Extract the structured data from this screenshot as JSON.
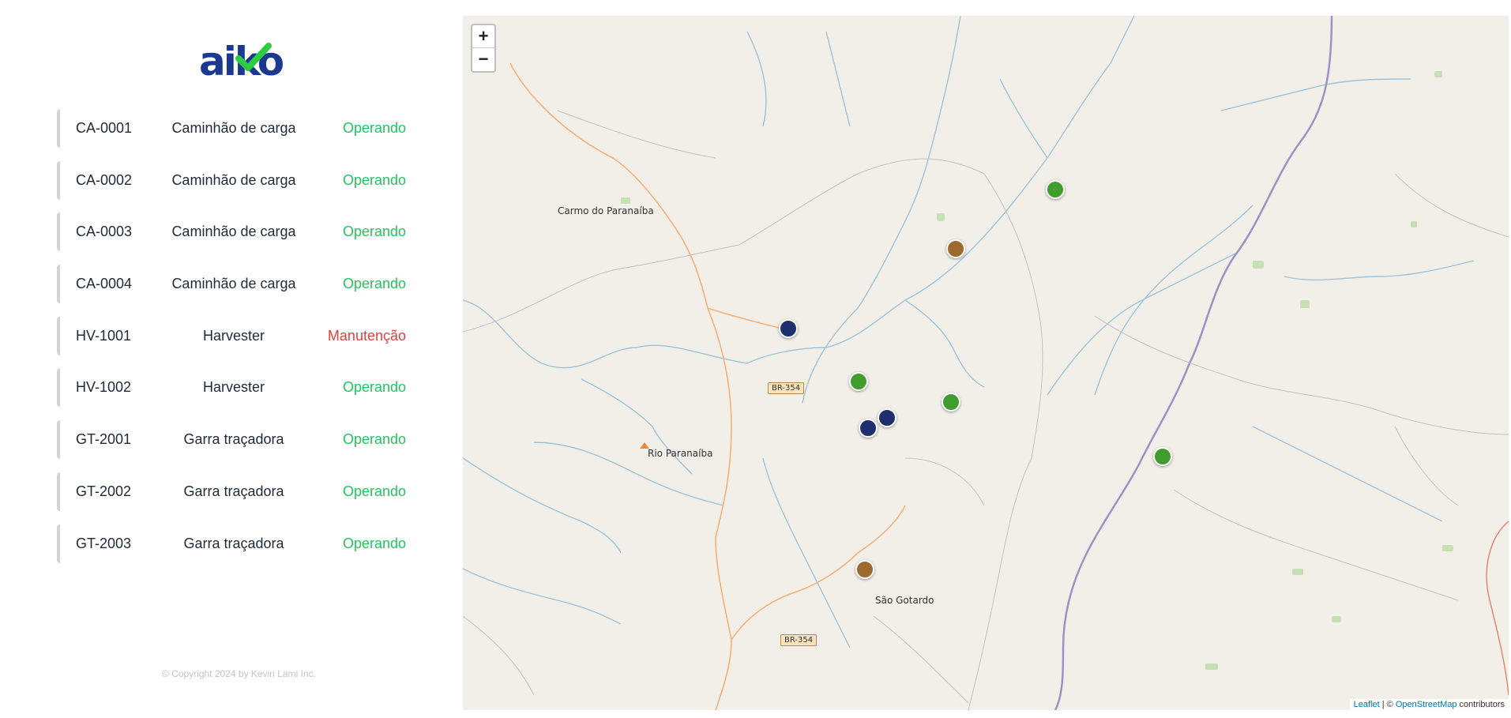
{
  "brand": {
    "logo_text": "aiko",
    "check_color": "#2ecc40",
    "logo_color": "#1b3a8f"
  },
  "equipment": [
    {
      "code": "CA-0001",
      "model": "Caminhão de carga",
      "state": "Operando",
      "state_color": "#22c55e"
    },
    {
      "code": "CA-0002",
      "model": "Caminhão de carga",
      "state": "Operando",
      "state_color": "#22c55e"
    },
    {
      "code": "CA-0003",
      "model": "Caminhão de carga",
      "state": "Operando",
      "state_color": "#22c55e"
    },
    {
      "code": "CA-0004",
      "model": "Caminhão de carga",
      "state": "Operando",
      "state_color": "#22c55e"
    },
    {
      "code": "HV-1001",
      "model": "Harvester",
      "state": "Manutenção",
      "state_color": "#e53e3e"
    },
    {
      "code": "HV-1002",
      "model": "Harvester",
      "state": "Operando",
      "state_color": "#22c55e"
    },
    {
      "code": "GT-2001",
      "model": "Garra traçadora",
      "state": "Operando",
      "state_color": "#22c55e"
    },
    {
      "code": "GT-2002",
      "model": "Garra traçadora",
      "state": "Operando",
      "state_color": "#22c55e"
    },
    {
      "code": "GT-2003",
      "model": "Garra traçadora",
      "state": "Operando",
      "state_color": "#22c55e"
    }
  ],
  "footer": {
    "copyright": "© Copyright 2024 by Kevin Lami Inc."
  },
  "map": {
    "zoom_in": "+",
    "zoom_out": "−",
    "places": [
      "Carmo do Paranaíba",
      "Rio Paranaíba",
      "São Gotardo"
    ],
    "road_label": "BR-354",
    "attribution": {
      "leaflet": "Leaflet",
      "separator": " | © ",
      "osm": "OpenStreetMap",
      "suffix": " contributors"
    },
    "marker_colors": {
      "operating": "#3f9c2d",
      "maintenance": "#9b6a2c",
      "stopped": "#1e2f6e"
    }
  }
}
